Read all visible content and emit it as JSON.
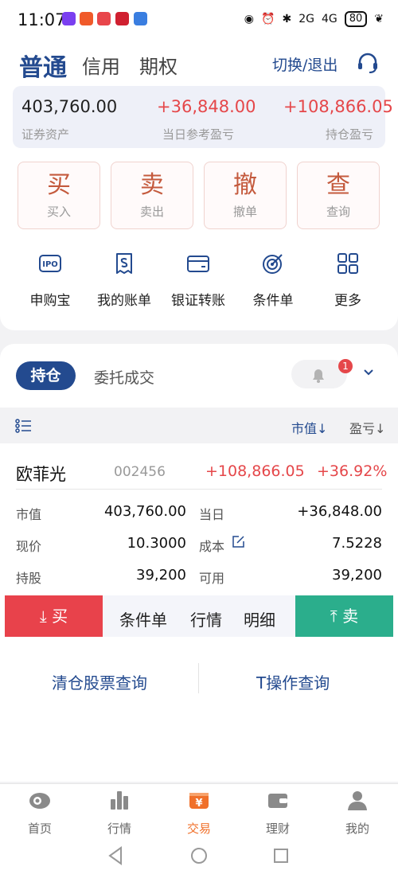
{
  "status_bar": {
    "time": "11:07",
    "signal_2g": "2G",
    "signal_4g": "4G",
    "battery": "80"
  },
  "header": {
    "tabs": [
      "普通",
      "信用",
      "期权"
    ],
    "switch_logout": "切换/退出",
    "service_icon": "headset-icon"
  },
  "assets": {
    "securities_value": "403,760.00",
    "securities_label": "证券资产",
    "daily_pnl": "+36,848.00",
    "daily_pnl_label": "当日参考盈亏",
    "holding_pnl": "+108,866.05",
    "holding_pnl_label": "持仓盈亏"
  },
  "actions": [
    {
      "big": "买",
      "small": "买入"
    },
    {
      "big": "卖",
      "small": "卖出"
    },
    {
      "big": "撤",
      "small": "撤单"
    },
    {
      "big": "查",
      "small": "查询"
    }
  ],
  "tools": [
    {
      "label": "申购宝",
      "icon": "ipo-icon",
      "icon_text": "IPO"
    },
    {
      "label": "我的账单",
      "icon": "bill-icon"
    },
    {
      "label": "银证转账",
      "icon": "card-icon"
    },
    {
      "label": "条件单",
      "icon": "target-icon"
    },
    {
      "label": "更多",
      "icon": "grid-icon"
    }
  ],
  "holdings_tabs": {
    "active": "持仓",
    "other": "委托成交",
    "badge": "1"
  },
  "sort": {
    "market_value": "市值↓",
    "pnl": "盈亏↓"
  },
  "stock": {
    "name": "欧菲光",
    "code": "002456",
    "pnl": "+108,866.05",
    "pnl_pct": "+36.92%",
    "market_value_label": "市值",
    "market_value": "403,760.00",
    "today_label": "当日",
    "today": "+36,848.00",
    "price_label": "现价",
    "price": "10.3000",
    "cost_label": "成本",
    "cost": "7.5228",
    "shares_label": "持股",
    "shares": "39,200",
    "available_label": "可用",
    "available": "39,200"
  },
  "stock_actions": {
    "buy": "买",
    "conditional": "条件单",
    "quote": "行情",
    "detail": "明细",
    "sell": "卖"
  },
  "bottom_links": {
    "clear_query": "清仓股票查询",
    "t_query": "T操作查询"
  },
  "tabbar": [
    {
      "label": "首页",
      "icon": "home-icon"
    },
    {
      "label": "行情",
      "icon": "bar-chart-icon"
    },
    {
      "label": "交易",
      "icon": "trade-icon",
      "icon_text": "¥"
    },
    {
      "label": "理财",
      "icon": "wallet-icon"
    },
    {
      "label": "我的",
      "icon": "user-icon"
    }
  ],
  "colors": {
    "brand": "#234a8f",
    "up": "#e5474a",
    "sell": "#2bae8c",
    "active_tab": "#f0702a"
  }
}
